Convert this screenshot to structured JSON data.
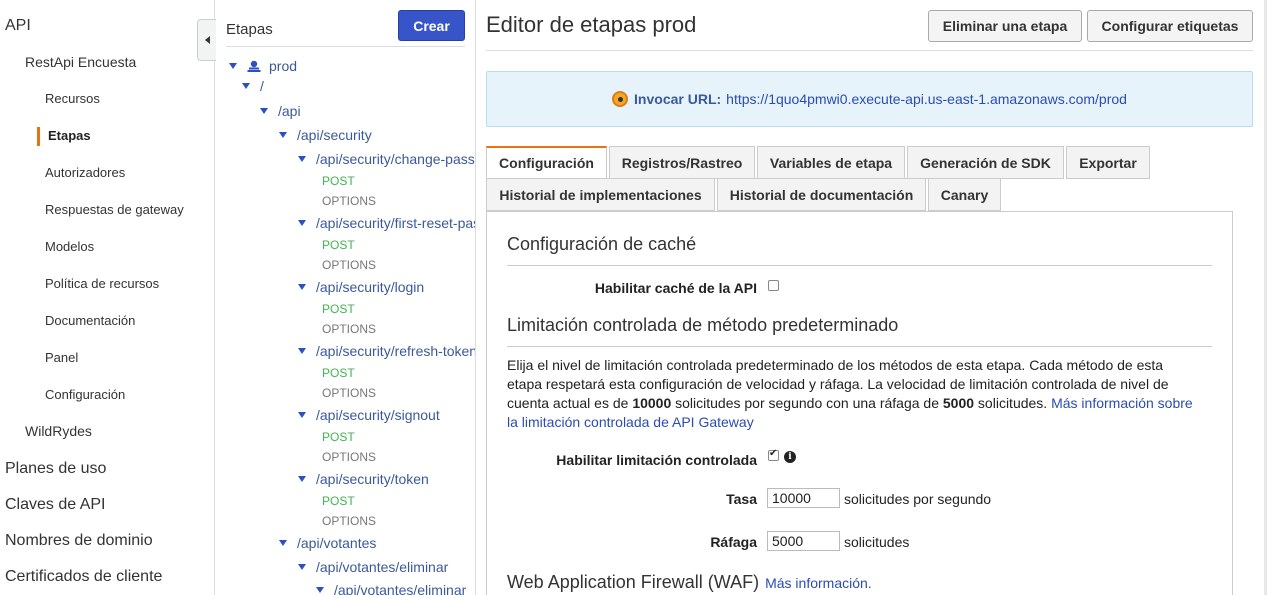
{
  "nav": {
    "api": "API",
    "api_name": "RestApi Encuesta",
    "sub_items": [
      "Recursos",
      "Etapas",
      "Autorizadores",
      "Respuestas de gateway",
      "Modelos",
      "Política de recursos",
      "Documentación",
      "Panel",
      "Configuración"
    ],
    "other_api": "WildRydes",
    "bottom_items": [
      "Planes de uso",
      "Claves de API",
      "Nombres de dominio",
      "Certificados de cliente"
    ]
  },
  "stages": {
    "title": "Etapas",
    "create_label": "Crear",
    "stage_name": "prod",
    "root": "/",
    "paths": {
      "api": "/api",
      "security": "/api/security",
      "change": "/api/security/change-password",
      "first_reset": "/api/security/first-reset-password",
      "login": "/api/security/login",
      "refresh": "/api/security/refresh-token",
      "signout": "/api/security/signout",
      "token": "/api/security/token",
      "votantes": "/api/votantes",
      "eliminar": "/api/votantes/eliminar",
      "eliminar_sub": "/api/votantes/eliminar"
    },
    "methods": {
      "post": "POST",
      "options": "OPTIONS"
    }
  },
  "main": {
    "title": "Editor de etapas prod",
    "delete_stage": "Eliminar una etapa",
    "configure_tags": "Configurar etiquetas",
    "invoke_label": "Invocar URL:",
    "invoke_url": "https://1quo4pmwi0.execute-api.us-east-1.amazonaws.com/prod",
    "tabs_row1": [
      "Configuración",
      "Registros/Rastreo",
      "Variables de etapa",
      "Generación de SDK",
      "Exportar"
    ],
    "tabs_row2": [
      "Historial de implementaciones",
      "Historial de documentación",
      "Canary"
    ],
    "cache": {
      "heading": "Configuración de caché",
      "enable_label": "Habilitar caché de la API",
      "enabled": false
    },
    "throttling": {
      "heading": "Limitación controlada de método predeterminado",
      "desc_part1": "Elija el nivel de limitación controlada predeterminado de los métodos de esta etapa. Cada método de esta etapa respetará esta configuración de velocidad y ráfaga. La velocidad de limitación controlada de nivel de cuenta actual es de ",
      "rate_limit": "10000",
      "desc_part2": " solicitudes por segundo con una ráfaga de ",
      "burst_limit": "5000",
      "desc_part3": " solicitudes. ",
      "desc_link": "Más información sobre la limitación controlada de API Gateway",
      "enable_label": "Habilitar limitación controlada",
      "enabled": true,
      "rate_label": "Tasa",
      "rate_value": "10000",
      "rate_unit": "solicitudes por segundo",
      "burst_label": "Ráfaga",
      "burst_value": "5000",
      "burst_unit": "solicitudes"
    },
    "waf": {
      "heading": "Web Application Firewall (WAF)",
      "link": "Más información."
    }
  },
  "colors": {
    "accent": "#ec7211",
    "primary_button": "#3754c9",
    "post": "#3fb34f",
    "link": "#2a4cb3"
  }
}
